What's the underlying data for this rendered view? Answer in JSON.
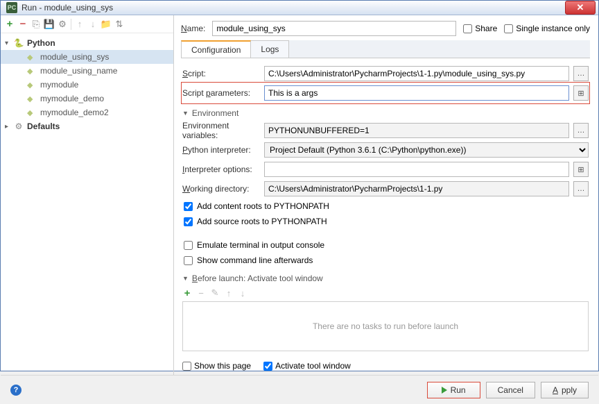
{
  "window": {
    "title": "Run - module_using_sys"
  },
  "sidebar": {
    "nodes": [
      {
        "label": "Python",
        "expanded": true,
        "children": [
          {
            "label": "module_using_sys",
            "selected": true
          },
          {
            "label": "module_using_name"
          },
          {
            "label": "mymodule"
          },
          {
            "label": "mymodule_demo"
          },
          {
            "label": "mymodule_demo2"
          }
        ]
      },
      {
        "label": "Defaults",
        "expanded": false
      }
    ]
  },
  "top": {
    "name_label": "Name:",
    "name_value": "module_using_sys",
    "share_label": "Share",
    "single_instance_label": "Single instance only"
  },
  "tabs": {
    "config": "Configuration",
    "logs": "Logs"
  },
  "form": {
    "script_label": "Script:",
    "script_value": "C:\\Users\\Administrator\\PycharmProjects\\1-1.py\\module_using_sys.py",
    "params_label": "Script parameters:",
    "params_value": "This is a args",
    "env_header": "Environment",
    "env_vars_label": "Environment variables:",
    "env_vars_value": "PYTHONUNBUFFERED=1",
    "interpreter_label": "Python interpreter:",
    "interpreter_value": "Project Default (Python 3.6.1 (C:\\Python\\python.exe))",
    "interp_opts_label": "Interpreter options:",
    "interp_opts_value": "",
    "workdir_label": "Working directory:",
    "workdir_value": "C:\\Users\\Administrator\\PycharmProjects\\1-1.py",
    "add_content_roots": "Add content roots to PYTHONPATH",
    "add_source_roots": "Add source roots to PYTHONPATH",
    "emulate_terminal": "Emulate terminal in output console",
    "show_cmd_after": "Show command line afterwards"
  },
  "before_launch": {
    "header": "Before launch: Activate tool window",
    "empty_text": "There are no tasks to run before launch",
    "show_this_page": "Show this page",
    "activate_tool_window": "Activate tool window"
  },
  "buttons": {
    "run": "Run",
    "cancel": "Cancel",
    "apply": "Apply"
  }
}
